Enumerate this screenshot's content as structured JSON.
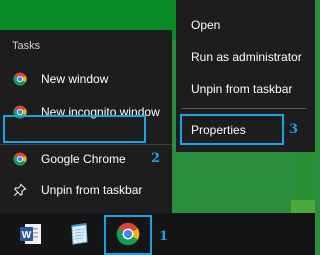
{
  "jumplist": {
    "heading": "Tasks",
    "items": [
      {
        "label": "New window",
        "icon": "chrome-icon"
      },
      {
        "label": "New incognito window",
        "icon": "chrome-icon"
      },
      {
        "label": "Google Chrome",
        "icon": "chrome-icon"
      },
      {
        "label": "Unpin from taskbar",
        "icon": "unpin-icon"
      }
    ]
  },
  "context_menu": {
    "items": [
      {
        "label": "Open"
      },
      {
        "label": "Run as administrator"
      },
      {
        "label": "Unpin from taskbar"
      },
      {
        "label": "Properties"
      }
    ]
  },
  "markers": {
    "one": "1",
    "two": "2",
    "three": "3"
  },
  "taskbar": {
    "buttons": [
      {
        "icon": "word-icon"
      },
      {
        "icon": "notepad-icon"
      },
      {
        "icon": "chrome-icon",
        "active": true
      }
    ]
  },
  "colors": {
    "highlight": "#1aa3e6",
    "menu_bg": "#1d1d1d",
    "taskbar_bg": "#151515",
    "desktop": "#2c8e3c"
  }
}
